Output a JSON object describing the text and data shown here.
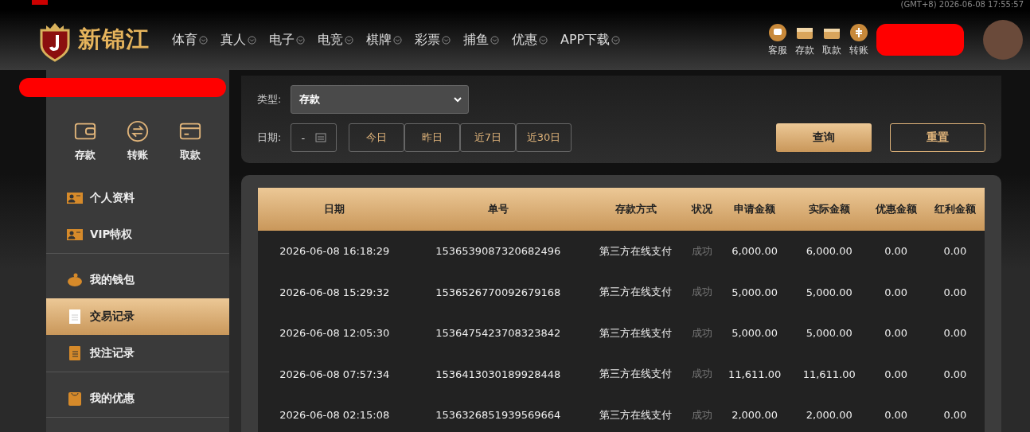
{
  "header": {
    "clock": "(GMT+8) 2026-06-08 17:55:57",
    "logo": "新锦江",
    "nav": [
      {
        "label": "体育"
      },
      {
        "label": "真人"
      },
      {
        "label": "电子"
      },
      {
        "label": "电竞"
      },
      {
        "label": "棋牌"
      },
      {
        "label": "彩票"
      },
      {
        "label": "捕鱼"
      },
      {
        "label": "优惠"
      },
      {
        "label": "APP下载"
      }
    ],
    "quick": [
      {
        "kind": "chat",
        "label": "客服"
      },
      {
        "kind": "wallet",
        "label": "存款"
      },
      {
        "kind": "case",
        "label": "取款"
      },
      {
        "kind": "coin",
        "label": "转账"
      }
    ]
  },
  "sidebar": {
    "actions": [
      {
        "kind": "wallet",
        "label": "存款"
      },
      {
        "kind": "transfer",
        "label": "转账"
      },
      {
        "kind": "card",
        "label": "取款"
      }
    ],
    "groups": [
      [
        {
          "kind": "id",
          "label": "个人资料",
          "selected": false
        },
        {
          "kind": "id",
          "label": "VIP特权",
          "selected": false
        }
      ],
      [
        {
          "kind": "pig",
          "label": "我的钱包",
          "selected": false
        },
        {
          "kind": "doc",
          "label": "交易记录",
          "selected": true
        },
        {
          "kind": "doc2",
          "label": "投注记录",
          "selected": false
        }
      ],
      [
        {
          "kind": "bag",
          "label": "我的优惠",
          "selected": false
        }
      ]
    ]
  },
  "filter": {
    "type_label": "类型:",
    "type_value": "存款",
    "date_label": "日期:",
    "date_value": "-",
    "ranges": [
      {
        "label": "今日"
      },
      {
        "label": "昨日"
      },
      {
        "label": "近7日"
      },
      {
        "label": "近30日"
      }
    ],
    "buttons": [
      {
        "kind": "primary",
        "label": "查询"
      },
      {
        "kind": "outline",
        "label": "重置"
      }
    ]
  },
  "table": {
    "columns": [
      "日期",
      "单号",
      "存款方式",
      "状况",
      "申请金额",
      "实际金额",
      "优惠金额",
      "红利金额"
    ],
    "rows": [
      [
        "2026-06-08 16:18:29",
        "1536539087320682496",
        "第三方在线支付",
        "成功",
        "6,000.00",
        "6,000.00",
        "0.00",
        "0.00"
      ],
      [
        "2026-06-08 15:29:32",
        "1536526770092679168",
        "第三方在线支付",
        "成功",
        "5,000.00",
        "5,000.00",
        "0.00",
        "0.00"
      ],
      [
        "2026-06-08 12:05:30",
        "1536475423708323842",
        "第三方在线支付",
        "成功",
        "5,000.00",
        "5,000.00",
        "0.00",
        "0.00"
      ],
      [
        "2026-06-08 07:57:34",
        "1536413030189928448",
        "第三方在线支付",
        "成功",
        "11,611.00",
        "11,611.00",
        "0.00",
        "0.00"
      ],
      [
        "2026-06-08 02:15:08",
        "1536326851939569664",
        "第三方在线支付",
        "成功",
        "2,000.00",
        "2,000.00",
        "0.00",
        "0.00"
      ]
    ]
  }
}
